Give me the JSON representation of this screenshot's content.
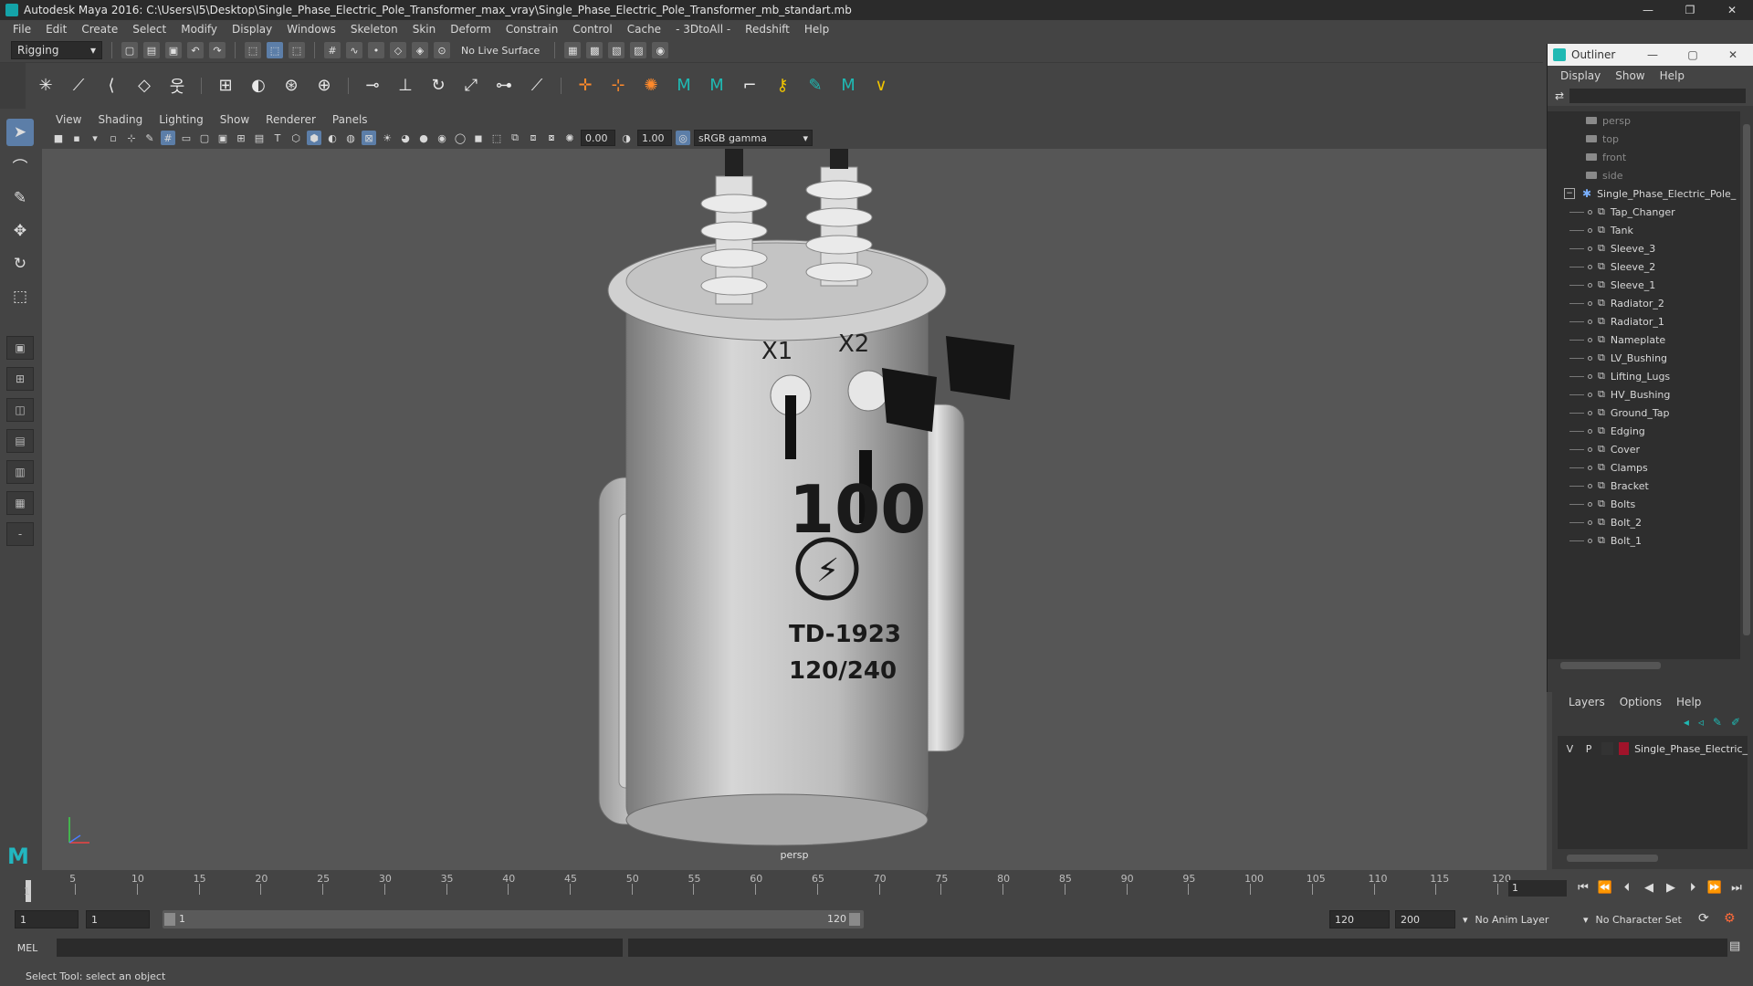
{
  "window": {
    "title": "Autodesk Maya 2016: C:\\Users\\I5\\Desktop\\Single_Phase_Electric_Pole_Transformer_max_vray\\Single_Phase_Electric_Pole_Transformer_mb_standart.mb",
    "minimize": "—",
    "maximize": "❐",
    "close": "✕"
  },
  "menubar": [
    "File",
    "Edit",
    "Create",
    "Select",
    "Modify",
    "Display",
    "Windows",
    "Skeleton",
    "Skin",
    "Deform",
    "Constrain",
    "Control",
    "Cache",
    "- 3DtoAll -",
    "Redshift",
    "Help"
  ],
  "statusline": {
    "menuset": "Rigging",
    "live_surface": "No Live Surface"
  },
  "panel": {
    "menus": [
      "View",
      "Shading",
      "Lighting",
      "Show",
      "Renderer",
      "Panels"
    ],
    "exposure": "0.00",
    "gamma": "1.00",
    "colorspace": "sRGB gamma",
    "camera_label": "persp"
  },
  "viewport_model": {
    "label_x1": "X1",
    "label_x2": "X2",
    "rating": "100",
    "model_code": "TD-1923",
    "voltage": "120/240"
  },
  "outliner": {
    "title": "Outliner",
    "menus": [
      "Display",
      "Show",
      "Help"
    ],
    "cameras": [
      "persp",
      "top",
      "front",
      "side"
    ],
    "group": "Single_Phase_Electric_Pole_",
    "children": [
      "Tap_Changer",
      "Tank",
      "Sleeve_3",
      "Sleeve_2",
      "Sleeve_1",
      "Radiator_2",
      "Radiator_1",
      "Nameplate",
      "LV_Bushing",
      "Lifting_Lugs",
      "HV_Bushing",
      "Ground_Tap",
      "Edging",
      "Cover",
      "Clamps",
      "Bracket",
      "Bolts",
      "Bolt_2",
      "Bolt_1"
    ]
  },
  "layers": {
    "menus": [
      "Layers",
      "Options",
      "Help"
    ],
    "row": {
      "visible": "V",
      "playback": "P",
      "name": "Single_Phase_Electric_",
      "color": "#a0132a"
    }
  },
  "timeslider": {
    "ticks": [
      "5",
      "10",
      "15",
      "20",
      "25",
      "30",
      "35",
      "40",
      "45",
      "50",
      "55",
      "60",
      "65",
      "70",
      "75",
      "80",
      "85",
      "90",
      "95",
      "100",
      "105",
      "110",
      "115",
      "120"
    ],
    "start_label": "1",
    "current_frame": "1"
  },
  "range": {
    "start": "1",
    "anim_start": "1",
    "range_start": "1",
    "range_end": "120",
    "end": "120",
    "anim_end": "200",
    "anim_layer": "No Anim Layer",
    "character_set": "No Character Set"
  },
  "cmdline": {
    "mode": "MEL"
  },
  "helpline": {
    "text": "Select Tool: select an object"
  },
  "colors": {
    "accent": "#5c7ea8",
    "teal": "#1fb9b3",
    "layer_red": "#a0132a"
  }
}
